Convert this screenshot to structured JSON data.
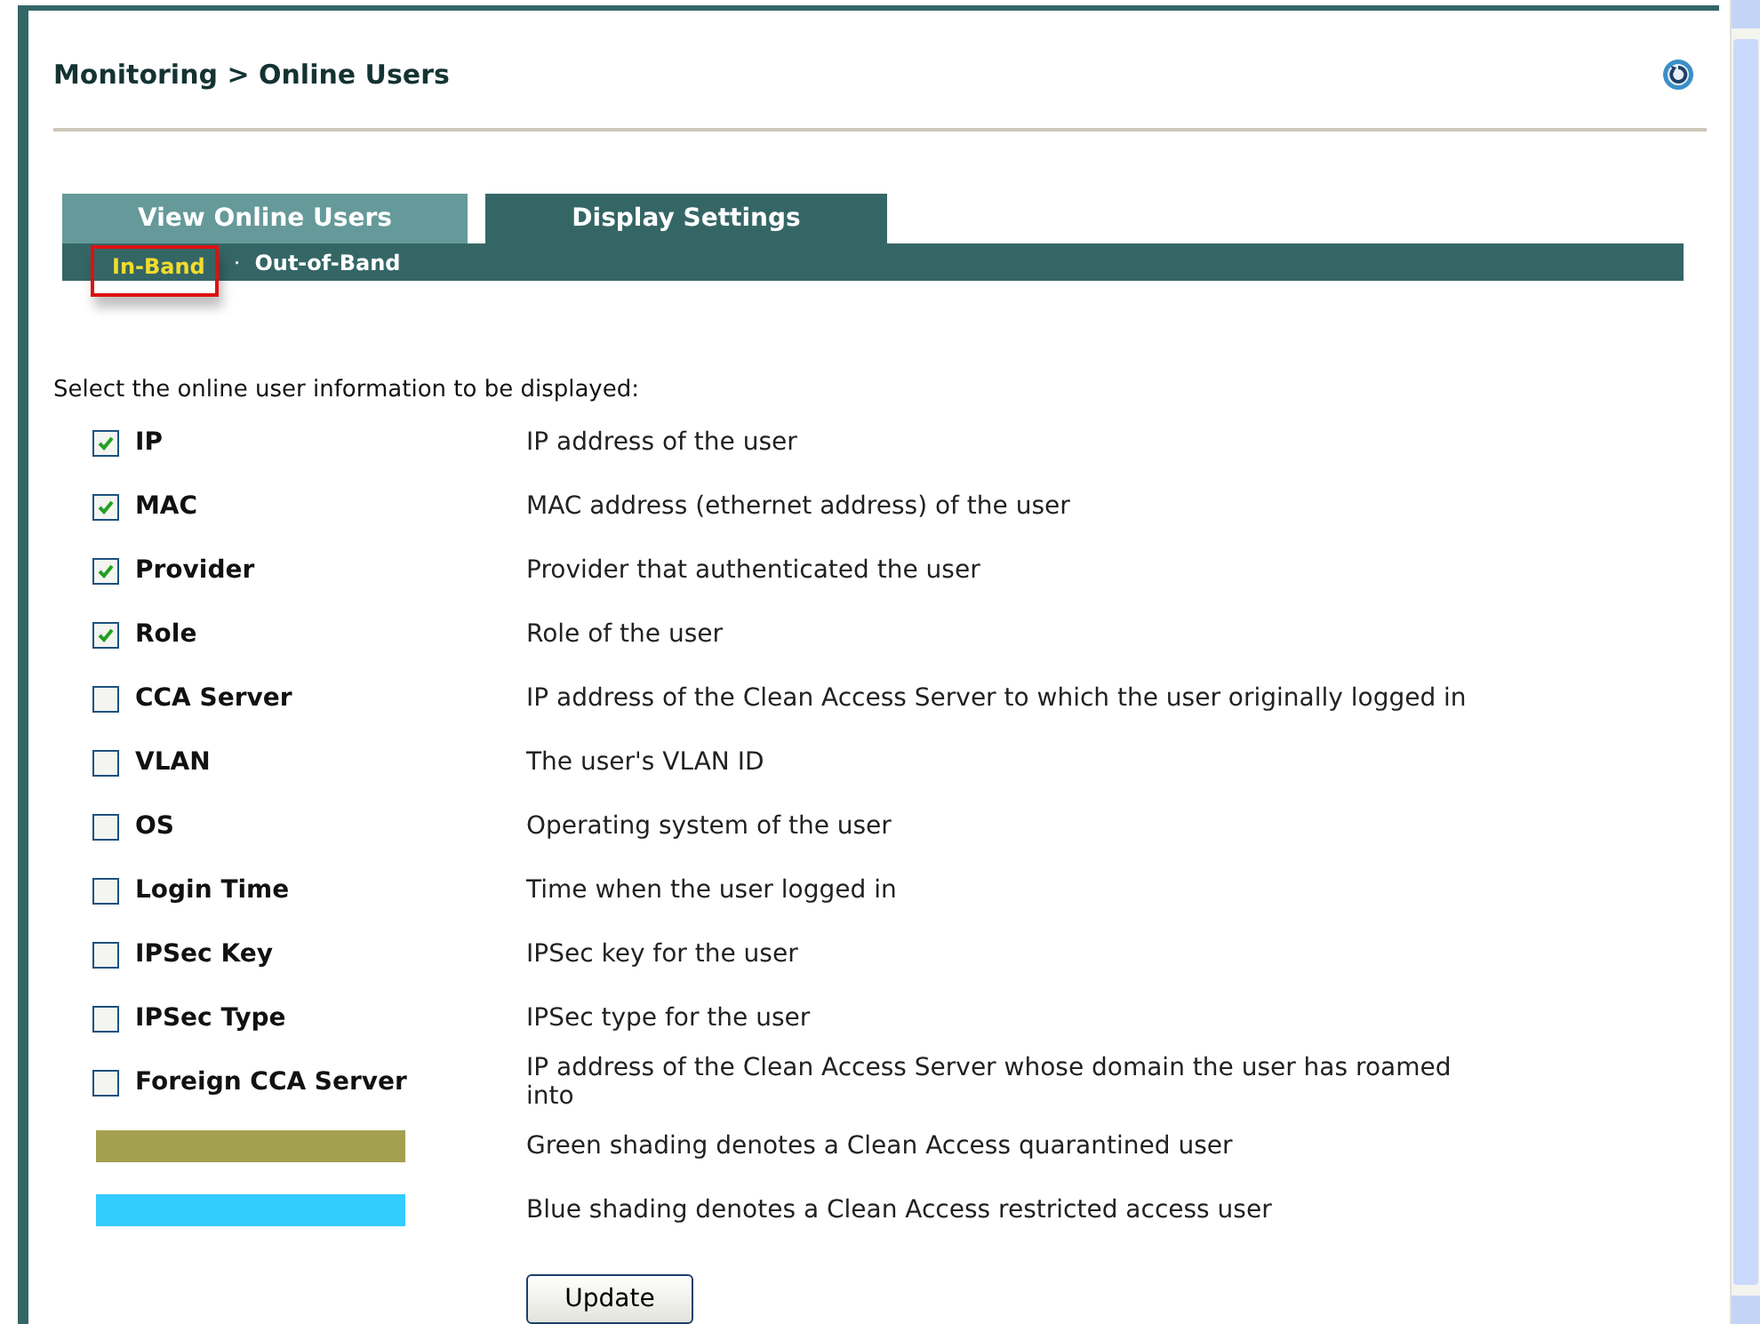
{
  "breadcrumb": "Monitoring > Online Users",
  "tabs": [
    {
      "label": "View Online Users",
      "selected": false
    },
    {
      "label": "Display Settings",
      "selected": true
    }
  ],
  "subtabs": [
    {
      "label": "In-Band",
      "selected": true,
      "highlighted": true
    },
    {
      "label": "Out-of-Band",
      "selected": false,
      "highlighted": false
    }
  ],
  "subtab_separator": "·",
  "intro": "Select the online user information to be displayed:",
  "fields": [
    {
      "label": "IP",
      "description": "IP address of the user",
      "checked": true
    },
    {
      "label": "MAC",
      "description": "MAC address (ethernet address) of the user",
      "checked": true
    },
    {
      "label": "Provider",
      "description": "Provider that authenticated the user",
      "checked": true
    },
    {
      "label": "Role",
      "description": "Role of the user",
      "checked": true
    },
    {
      "label": "CCA Server",
      "description": "IP address of the Clean Access Server to which the user originally logged in",
      "checked": false
    },
    {
      "label": "VLAN",
      "description": "The user's VLAN ID",
      "checked": false
    },
    {
      "label": "OS",
      "description": "Operating system of the user",
      "checked": false
    },
    {
      "label": "Login Time",
      "description": "Time when the user logged in",
      "checked": false
    },
    {
      "label": "IPSec Key",
      "description": "IPSec key for the user",
      "checked": false
    },
    {
      "label": "IPSec Type",
      "description": "IPSec type for the user",
      "checked": false
    },
    {
      "label": "Foreign CCA Server",
      "description": "IP address of the Clean Access Server whose domain the user has roamed into",
      "checked": false
    }
  ],
  "legend": [
    {
      "color": "#a3a052",
      "description": "Green shading denotes a Clean Access quarantined user"
    },
    {
      "color": "#33ccff",
      "description": "Blue shading denotes a Clean Access restricted access user"
    }
  ],
  "update_button": "Update"
}
